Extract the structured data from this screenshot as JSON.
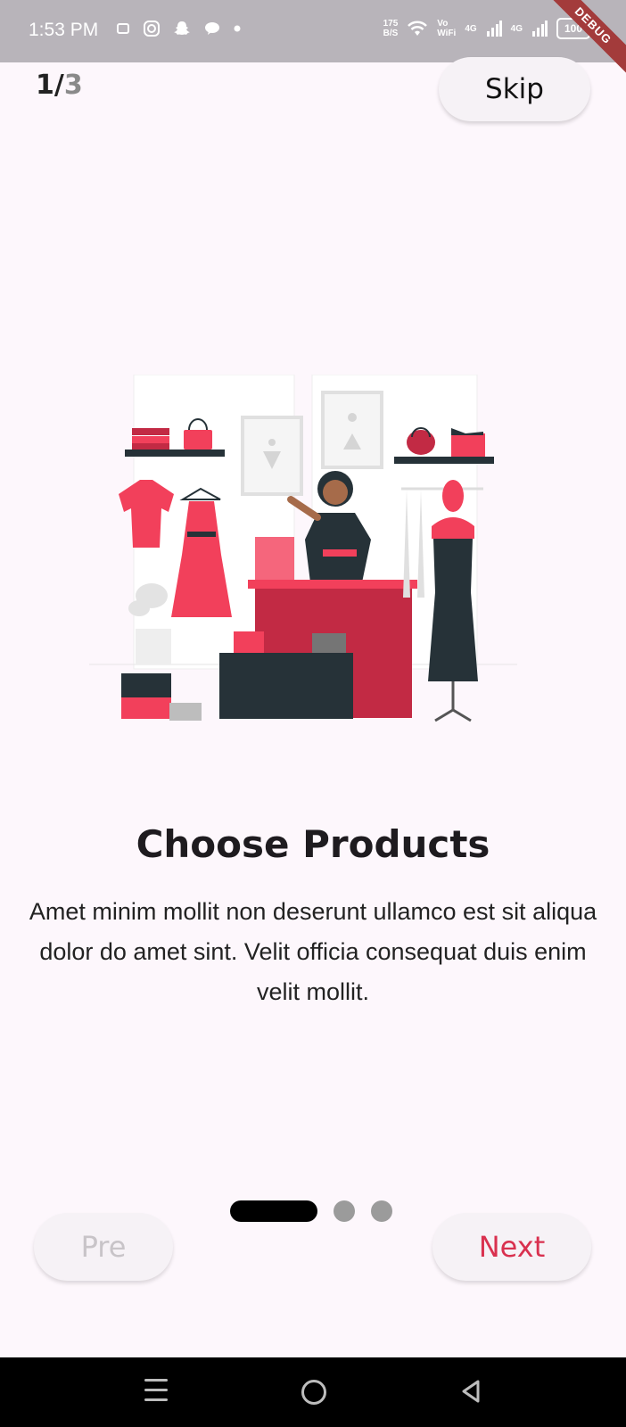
{
  "status_bar": {
    "time": "1:53 PM",
    "speed_value": "175",
    "speed_unit": "B/S",
    "vowifi_top": "Vo",
    "vowifi_bottom": "WiFi",
    "net1": "4G",
    "net2": "4G",
    "battery": "100",
    "debug_label": "DEBUG"
  },
  "header": {
    "current_page": "1",
    "separator": "/",
    "total_pages": "3",
    "skip_label": "Skip"
  },
  "onboarding": {
    "title": "Choose Products",
    "description": "Amet minim mollit non deserunt ullamco est sit aliqua dolor do amet sint. Velit officia consequat duis enim velit mollit."
  },
  "indicator": {
    "active_index": 0,
    "count": 3
  },
  "buttons": {
    "pre_label": "Pre",
    "next_label": "Next"
  },
  "colors": {
    "accent": "#d9314f",
    "illustration_red": "#f2405b",
    "illustration_dark": "#263238",
    "background": "#fdf7fc"
  }
}
